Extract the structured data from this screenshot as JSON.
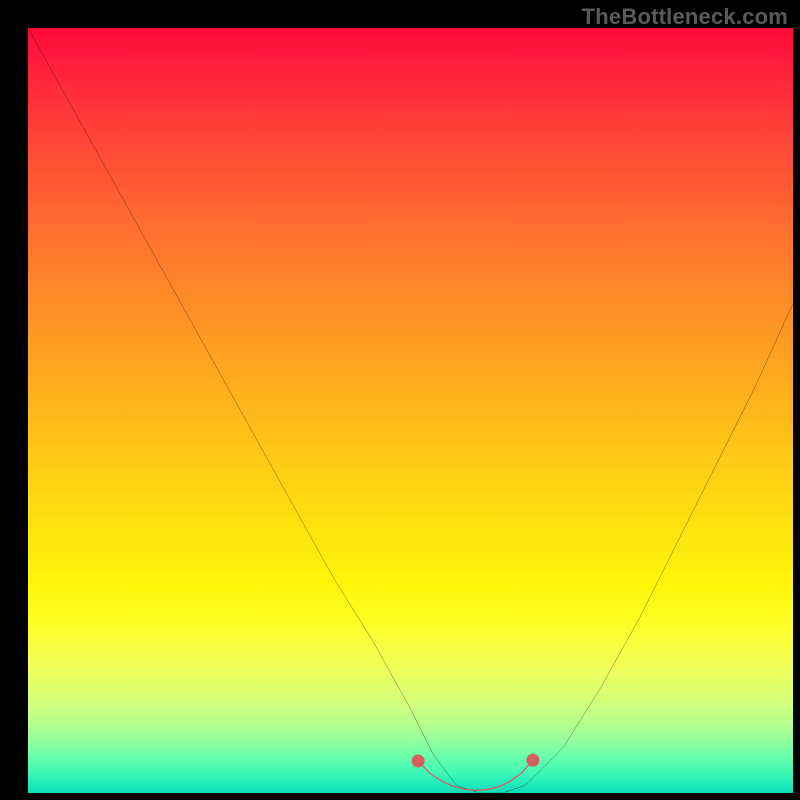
{
  "watermark": "TheBottleneck.com",
  "chart_data": {
    "type": "line",
    "title": "",
    "xlabel": "",
    "ylabel": "",
    "xlim": [
      0,
      100
    ],
    "ylim": [
      0,
      100
    ],
    "grid": false,
    "series": [
      {
        "name": "curve",
        "color": "#000000",
        "x": [
          0,
          5,
          10,
          15,
          20,
          25,
          30,
          35,
          40,
          45,
          50,
          53,
          56,
          59,
          62,
          65,
          70,
          75,
          80,
          85,
          90,
          95,
          100
        ],
        "y": [
          100,
          91,
          82,
          73,
          64,
          55,
          46,
          37,
          28,
          20,
          11,
          5,
          1,
          0,
          0,
          1,
          6,
          14,
          23,
          33,
          43,
          53,
          64
        ]
      },
      {
        "name": "valley-marker",
        "color": "#d35f5f",
        "x": [
          51,
          52.5,
          54,
          55.5,
          57,
          58.5,
          60,
          61.5,
          63,
          64.5,
          66
        ],
        "y": [
          4.2,
          2.6,
          1.6,
          0.9,
          0.5,
          0.35,
          0.45,
          0.8,
          1.5,
          2.6,
          4.3
        ]
      }
    ],
    "gradient_stops": [
      {
        "pos": 0,
        "color": "#ff0a3a"
      },
      {
        "pos": 14,
        "color": "#ff4338"
      },
      {
        "pos": 35,
        "color": "#ff8a28"
      },
      {
        "pos": 55,
        "color": "#ffc617"
      },
      {
        "pos": 78,
        "color": "#feff28"
      },
      {
        "pos": 92,
        "color": "#a8ff93"
      },
      {
        "pos": 100,
        "color": "#0edcb6"
      }
    ]
  }
}
